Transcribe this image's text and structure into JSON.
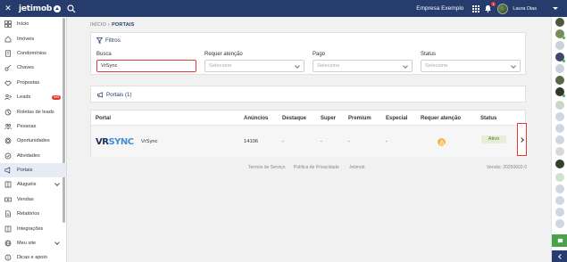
{
  "topbar": {
    "close_icon": "close-icon",
    "brand": "jetimob",
    "company": "Empresa Exemplo",
    "notification_count": "1",
    "user_name": "Laura Dias"
  },
  "sidebar": {
    "items": [
      {
        "label": "Início",
        "icon": "grid-icon"
      },
      {
        "label": "Imóveis",
        "icon": "home-icon"
      },
      {
        "label": "Condomínios",
        "icon": "building-icon"
      },
      {
        "label": "Chaves",
        "icon": "key-icon"
      },
      {
        "label": "Propostas",
        "icon": "handshake-icon"
      },
      {
        "label": "Leads",
        "icon": "leads-icon",
        "badge": "999"
      },
      {
        "label": "Roletas de leads",
        "icon": "roulette-icon"
      },
      {
        "label": "Pessoas",
        "icon": "people-icon"
      },
      {
        "label": "Oportunidades",
        "icon": "target-icon"
      },
      {
        "label": "Atividades",
        "icon": "check-circle-icon"
      },
      {
        "label": "Portais",
        "icon": "megaphone-icon"
      },
      {
        "label": "Aluguéis",
        "icon": "book-icon"
      },
      {
        "label": "Vendas",
        "icon": "money-icon"
      },
      {
        "label": "Relatórios",
        "icon": "report-icon"
      },
      {
        "label": "Integrações",
        "icon": "integration-icon"
      },
      {
        "label": "Meu site",
        "icon": "globe-icon"
      },
      {
        "label": "Dicas e apoio",
        "icon": "info-icon"
      }
    ]
  },
  "breadcrumb": {
    "home": "INÍCIO",
    "current": "PORTAIS"
  },
  "filters": {
    "title": "Filtros",
    "search_label": "Busca",
    "search_value": "VrSync",
    "attention_label": "Requer atenção",
    "paid_label": "Pago",
    "status_label": "Status",
    "select_placeholder": "Selecione"
  },
  "portals": {
    "title": "Portais (1)"
  },
  "table": {
    "headers": {
      "portal": "Portal",
      "ads": "Anúncios",
      "highlight": "Destaque",
      "super": "Super",
      "premium": "Premium",
      "special": "Especial",
      "attention": "Requer atenção",
      "status": "Status"
    },
    "row": {
      "logo_v": "VR",
      "logo_s": "SYNC",
      "name": "VrSync",
      "ads": "14106",
      "highlight": "-",
      "super": "-",
      "premium": "-",
      "special": "-",
      "status": "Ativo"
    }
  },
  "footer": {
    "terms": "Termos de Serviço",
    "privacy": "Política de Privacidade",
    "brand": "Jetimob",
    "version": "Versão: 20250602-0"
  },
  "colors": {
    "primary": "#253c6c",
    "danger": "#e53935",
    "success_bg": "#e6eed6",
    "warning": "#f6b54a"
  }
}
